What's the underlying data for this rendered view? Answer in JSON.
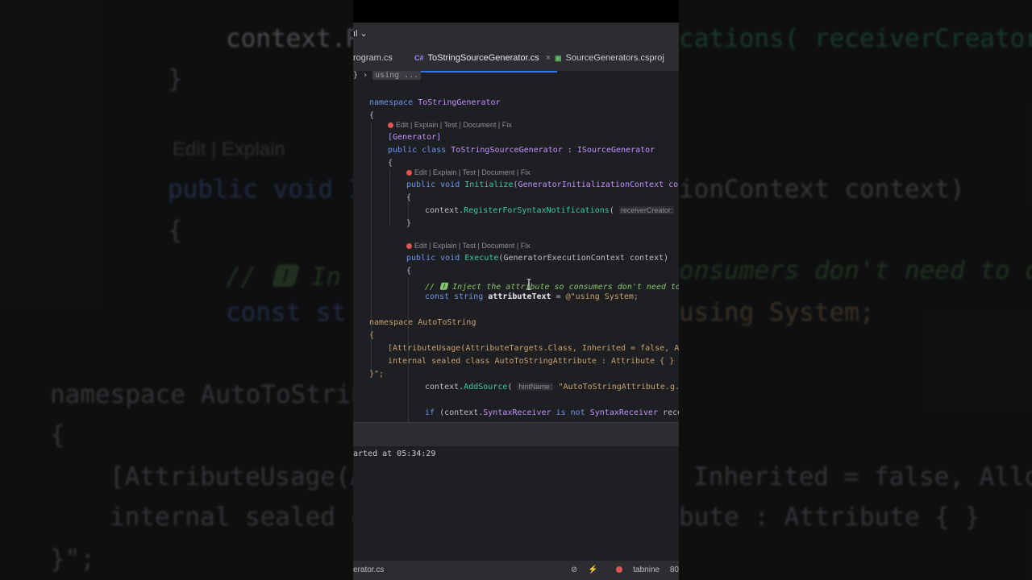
{
  "background": {
    "left_lines": [
      "context.R",
      "}",
      "Edit | Explain",
      "public void I",
      "{",
      "// 🅸 In",
      "const st",
      "namespace AutoToStrin",
      "{",
      "[AttributeUsage(A",
      "internal sealed c",
      "}\";"
    ],
    "right_lines": [
      "cations( receiverCreator: ()",
      "ionContext context)",
      "onsumers don't need to d",
      "using System;",
      "Inherited = false, Allo",
      "bute : Attribute { }"
    ]
  },
  "titlebar": {
    "branch": "ıl ⌄"
  },
  "tabs": [
    {
      "label": "rogram.cs",
      "icon": "",
      "active": false
    },
    {
      "label": "ToStringSourceGenerator.cs",
      "icon": "C#",
      "active": true,
      "close": "×"
    },
    {
      "label": "SourceGenerators.csproj",
      "icon": "▣",
      "active": false
    }
  ],
  "breadcrumb": {
    "arrow": "} ›",
    "text": "using ..."
  },
  "code": {
    "ns1_kw": "namespace",
    "ns1_name": "ToStringGenerator",
    "brace_open": "{",
    "lens1": "Edit | Explain | Test | Document | Fix",
    "attr_generator": "[Generator]",
    "cls_kw": "public class",
    "cls_name": "ToStringSourceGenerator",
    "cls_colon": " : ",
    "cls_iface": "ISourceGenerator",
    "brace2": "{",
    "lens2": "Edit | Explain | Test | Document | Fix",
    "init_kw": "public void",
    "init_fn": "Initialize",
    "init_params": "(GeneratorInitializationContext contex",
    "brace3": "{",
    "reg_obj": "context.",
    "reg_fn": "RegisterForSyntaxNotifications",
    "reg_paren": "(",
    "reg_hint": "receiverCreator:",
    "reg_tail": " ()",
    "brace3c": "}",
    "lens3": "Edit | Explain | Test | Document | Fix",
    "exec_kw": "public void",
    "exec_fn": "Execute",
    "exec_params": "(GeneratorExecutionContext context)",
    "brace4": "{",
    "comment": "// 🅸 Inject the attribute so consumers don't need to d",
    "const_kw": "const string",
    "const_name": "attributeText",
    "const_eq": " = ",
    "const_val": "@\"using System;",
    "ns2_kw": "namespace",
    "ns2_name": "AutoToString",
    "brace5": "{",
    "attrusage": "[AttributeUsage(AttributeTargets.Class, Inherited = false, Allow",
    "internal_line": "internal sealed class AutoToStringAttribute : Attribute { }",
    "str_end": "}\";",
    "add_obj": "context.",
    "add_fn": "AddSource",
    "add_paren": "(",
    "add_hint": "hintName:",
    "add_str": "\"AutoToStringAttribute.g.cs\",",
    "if_kw": "if",
    "if_mid": " (context.",
    "if_prop": "SyntaxReceiver",
    "if_is": " is not ",
    "if_type": "SyntaxReceiver",
    "if_tail": " receive"
  },
  "console": {
    "message": "arted at 05:34:29"
  },
  "statusbar": {
    "file": "erator.cs",
    "check": "⊘",
    "ai": "⚡",
    "tabnine": "tabnine",
    "col": "80"
  },
  "colors": {
    "keyword": "#6c95eb",
    "class": "#c191ff",
    "method": "#39cc9b",
    "string": "#c9a26d",
    "comment": "#85c46c",
    "accent": "#3574f0"
  }
}
